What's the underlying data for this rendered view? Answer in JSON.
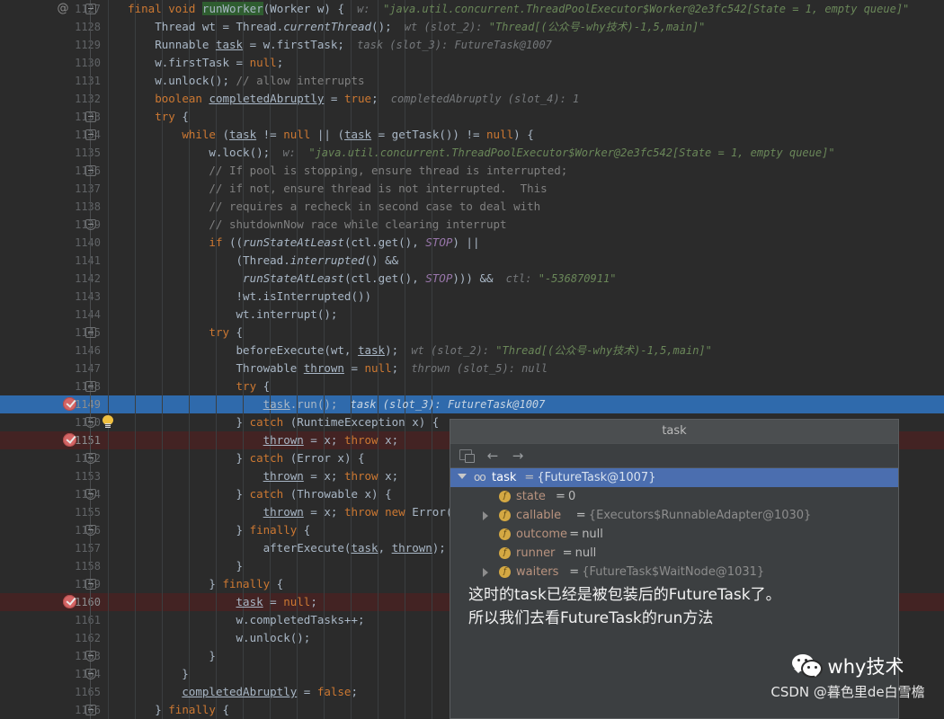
{
  "editor": {
    "first_line": 1127,
    "lines": [
      {
        "n": 1127,
        "indent": 0,
        "at": true,
        "fold": "start",
        "code": [
          {
            "t": "    ",
            "c": "txt"
          },
          {
            "t": "final",
            "c": "kw"
          },
          {
            "t": " ",
            "c": "txt"
          },
          {
            "t": "void",
            "c": "kw"
          },
          {
            "t": " ",
            "c": "txt"
          },
          {
            "t": "runWorker",
            "c": "hl"
          },
          {
            "t": "(Worker w) {",
            "c": "txt"
          }
        ],
        "hint": "  w:  ",
        "hintval": "\"java.util.concurrent.ThreadPoolExecutor$Worker@2e3fc542[State = 1, empty queue]\""
      },
      {
        "n": 1128,
        "code": [
          {
            "t": "        Thread wt = Thread.",
            "c": "txt"
          },
          {
            "t": "currentThread",
            "c": "itl"
          },
          {
            "t": "();",
            "c": "txt"
          }
        ],
        "hint": "  wt (slot_2): ",
        "hintval": "\"Thread[(公众号-why技术)-1,5,main]\""
      },
      {
        "n": 1129,
        "code": [
          {
            "t": "        Runnable ",
            "c": "txt"
          },
          {
            "t": "task",
            "c": "udl"
          },
          {
            "t": " = w.firstTask;",
            "c": "txt"
          }
        ],
        "hint": "  task (slot_3): FutureTask@1007",
        "hintval": ""
      },
      {
        "n": 1130,
        "code": [
          {
            "t": "        w.firstTask = ",
            "c": "txt"
          },
          {
            "t": "null",
            "c": "kw"
          },
          {
            "t": ";",
            "c": "txt"
          }
        ],
        "hint": "",
        "hintval": ""
      },
      {
        "n": 1131,
        "code": [
          {
            "t": "        w.unlock(); ",
            "c": "txt"
          },
          {
            "t": "// allow interrupts",
            "c": "cmt"
          }
        ],
        "hint": "",
        "hintval": ""
      },
      {
        "n": 1132,
        "code": [
          {
            "t": "        ",
            "c": "txt"
          },
          {
            "t": "boolean",
            "c": "kw"
          },
          {
            "t": " ",
            "c": "txt"
          },
          {
            "t": "completedAbruptly",
            "c": "udl"
          },
          {
            "t": " = ",
            "c": "txt"
          },
          {
            "t": "true",
            "c": "kw"
          },
          {
            "t": ";",
            "c": "txt"
          }
        ],
        "hint": "  completedAbruptly (slot_4): 1",
        "hintval": ""
      },
      {
        "n": 1133,
        "fold": "mid",
        "code": [
          {
            "t": "        ",
            "c": "txt"
          },
          {
            "t": "try",
            "c": "kw"
          },
          {
            "t": " {",
            "c": "txt"
          }
        ],
        "hint": "",
        "hintval": ""
      },
      {
        "n": 1134,
        "fold": "mid",
        "code": [
          {
            "t": "            ",
            "c": "txt"
          },
          {
            "t": "while",
            "c": "kw"
          },
          {
            "t": " (",
            "c": "txt"
          },
          {
            "t": "task",
            "c": "udl"
          },
          {
            "t": " != ",
            "c": "txt"
          },
          {
            "t": "null",
            "c": "kw"
          },
          {
            "t": " || (",
            "c": "txt"
          },
          {
            "t": "task",
            "c": "udl"
          },
          {
            "t": " = getTask()) != ",
            "c": "txt"
          },
          {
            "t": "null",
            "c": "kw"
          },
          {
            "t": ") {",
            "c": "txt"
          }
        ],
        "hint": "",
        "hintval": ""
      },
      {
        "n": 1135,
        "code": [
          {
            "t": "                w.lock();",
            "c": "txt"
          }
        ],
        "hint": "  w:  ",
        "hintval": "\"java.util.concurrent.ThreadPoolExecutor$Worker@2e3fc542[State = 1, empty queue]\""
      },
      {
        "n": 1136,
        "fold": "mid",
        "code": [
          {
            "t": "                // If pool is stopping, ensure thread is interrupted;",
            "c": "cmt"
          }
        ],
        "hint": "",
        "hintval": ""
      },
      {
        "n": 1137,
        "code": [
          {
            "t": "                // if not, ensure thread is not interrupted.  This",
            "c": "cmt"
          }
        ],
        "hint": "",
        "hintval": ""
      },
      {
        "n": 1138,
        "code": [
          {
            "t": "                // requires a recheck in second case to deal with",
            "c": "cmt"
          }
        ],
        "hint": "",
        "hintval": ""
      },
      {
        "n": 1139,
        "fold": "end",
        "code": [
          {
            "t": "                // shutdownNow race while clearing interrupt",
            "c": "cmt"
          }
        ],
        "hint": "",
        "hintval": ""
      },
      {
        "n": 1140,
        "code": [
          {
            "t": "                ",
            "c": "txt"
          },
          {
            "t": "if",
            "c": "kw"
          },
          {
            "t": " ((",
            "c": "txt"
          },
          {
            "t": "runStateAtLeast",
            "c": "itl"
          },
          {
            "t": "(ctl.get(), ",
            "c": "txt"
          },
          {
            "t": "STOP",
            "c": "stat"
          },
          {
            "t": ") ||",
            "c": "txt"
          }
        ],
        "hint": "",
        "hintval": ""
      },
      {
        "n": 1141,
        "code": [
          {
            "t": "                    (Thread.",
            "c": "txt"
          },
          {
            "t": "interrupted",
            "c": "itl"
          },
          {
            "t": "() &&",
            "c": "txt"
          }
        ],
        "hint": "",
        "hintval": ""
      },
      {
        "n": 1142,
        "code": [
          {
            "t": "                     ",
            "c": "txt"
          },
          {
            "t": "runStateAtLeast",
            "c": "itl"
          },
          {
            "t": "(ctl.get(), ",
            "c": "txt"
          },
          {
            "t": "STOP",
            "c": "stat"
          },
          {
            "t": "))) &&",
            "c": "txt"
          }
        ],
        "hint": "  ctl: ",
        "hintval": "\"-536870911\""
      },
      {
        "n": 1143,
        "code": [
          {
            "t": "                    !wt.isInterrupted())",
            "c": "txt"
          }
        ],
        "hint": "",
        "hintval": ""
      },
      {
        "n": 1144,
        "code": [
          {
            "t": "                    wt.interrupt();",
            "c": "txt"
          }
        ],
        "hint": "",
        "hintval": ""
      },
      {
        "n": 1145,
        "fold": "mid",
        "code": [
          {
            "t": "                ",
            "c": "txt"
          },
          {
            "t": "try",
            "c": "kw"
          },
          {
            "t": " {",
            "c": "txt"
          }
        ],
        "hint": "",
        "hintval": ""
      },
      {
        "n": 1146,
        "code": [
          {
            "t": "                    beforeExecute(wt, ",
            "c": "txt"
          },
          {
            "t": "task",
            "c": "udl"
          },
          {
            "t": ");",
            "c": "txt"
          }
        ],
        "hint": "  wt (slot_2): ",
        "hintval": "\"Thread[(公众号-why技术)-1,5,main]\""
      },
      {
        "n": 1147,
        "code": [
          {
            "t": "                    Throwable ",
            "c": "txt"
          },
          {
            "t": "thrown",
            "c": "udl"
          },
          {
            "t": " = ",
            "c": "txt"
          },
          {
            "t": "null",
            "c": "kw"
          },
          {
            "t": ";",
            "c": "txt"
          }
        ],
        "hint": "  thrown (slot_5): null",
        "hintval": ""
      },
      {
        "n": 1148,
        "fold": "mid",
        "code": [
          {
            "t": "                    ",
            "c": "txt"
          },
          {
            "t": "try",
            "c": "kw"
          },
          {
            "t": " {",
            "c": "txt"
          }
        ],
        "hint": "",
        "hintval": ""
      },
      {
        "n": 1149,
        "exec": true,
        "bp": true,
        "code": [
          {
            "t": "                        ",
            "c": "txt"
          },
          {
            "t": "task",
            "c": "udl"
          },
          {
            "t": ".run();",
            "c": "txt"
          }
        ],
        "hint": "  task (slot_3): FutureTask@1007",
        "hintval": ""
      },
      {
        "n": 1150,
        "fold": "end",
        "bulb": true,
        "code": [
          {
            "t": "                    } ",
            "c": "txt"
          },
          {
            "t": "catch",
            "c": "kw"
          },
          {
            "t": " (RuntimeException x) {",
            "c": "txt"
          }
        ],
        "hint": "",
        "hintval": ""
      },
      {
        "n": 1151,
        "bp": true,
        "bpline": true,
        "code": [
          {
            "t": "                        ",
            "c": "txt"
          },
          {
            "t": "thrown",
            "c": "udl"
          },
          {
            "t": " = x; ",
            "c": "txt"
          },
          {
            "t": "throw",
            "c": "kw"
          },
          {
            "t": " x;",
            "c": "txt"
          }
        ],
        "hint": "",
        "hintval": ""
      },
      {
        "n": 1152,
        "fold": "end",
        "code": [
          {
            "t": "                    } ",
            "c": "txt"
          },
          {
            "t": "catch",
            "c": "kw"
          },
          {
            "t": " (Error x) {",
            "c": "txt"
          }
        ],
        "hint": "",
        "hintval": ""
      },
      {
        "n": 1153,
        "code": [
          {
            "t": "                        ",
            "c": "txt"
          },
          {
            "t": "thrown",
            "c": "udl"
          },
          {
            "t": " = x; ",
            "c": "txt"
          },
          {
            "t": "throw",
            "c": "kw"
          },
          {
            "t": " x;",
            "c": "txt"
          }
        ],
        "hint": "",
        "hintval": ""
      },
      {
        "n": 1154,
        "fold": "end",
        "code": [
          {
            "t": "                    } ",
            "c": "txt"
          },
          {
            "t": "catch",
            "c": "kw"
          },
          {
            "t": " (Throwable x) {",
            "c": "txt"
          }
        ],
        "hint": "",
        "hintval": ""
      },
      {
        "n": 1155,
        "code": [
          {
            "t": "                        ",
            "c": "txt"
          },
          {
            "t": "thrown",
            "c": "udl"
          },
          {
            "t": " = x; ",
            "c": "txt"
          },
          {
            "t": "throw",
            "c": "kw"
          },
          {
            "t": " ",
            "c": "txt"
          },
          {
            "t": "new",
            "c": "kw"
          },
          {
            "t": " Error(x);",
            "c": "txt"
          }
        ],
        "hint": "",
        "hintval": ""
      },
      {
        "n": 1156,
        "fold": "end",
        "code": [
          {
            "t": "                    } ",
            "c": "txt"
          },
          {
            "t": "finally",
            "c": "kw"
          },
          {
            "t": " {",
            "c": "txt"
          }
        ],
        "hint": "",
        "hintval": ""
      },
      {
        "n": 1157,
        "code": [
          {
            "t": "                        afterExecute(",
            "c": "txt"
          },
          {
            "t": "task",
            "c": "udl"
          },
          {
            "t": ", ",
            "c": "txt"
          },
          {
            "t": "thrown",
            "c": "udl"
          },
          {
            "t": ");",
            "c": "txt"
          }
        ],
        "hint": "",
        "hintval": ""
      },
      {
        "n": 1158,
        "code": [
          {
            "t": "                    }",
            "c": "txt"
          }
        ],
        "hint": "",
        "hintval": ""
      },
      {
        "n": 1159,
        "fold": "mid",
        "code": [
          {
            "t": "                } ",
            "c": "txt"
          },
          {
            "t": "finally",
            "c": "kw"
          },
          {
            "t": " {",
            "c": "txt"
          }
        ],
        "hint": "",
        "hintval": ""
      },
      {
        "n": 1160,
        "bp": true,
        "bpline": true,
        "code": [
          {
            "t": "                    ",
            "c": "txt"
          },
          {
            "t": "task",
            "c": "udl"
          },
          {
            "t": " = ",
            "c": "txt"
          },
          {
            "t": "null",
            "c": "kw"
          },
          {
            "t": ";",
            "c": "txt"
          }
        ],
        "hint": "",
        "hintval": ""
      },
      {
        "n": 1161,
        "code": [
          {
            "t": "                    w.completedTasks++;",
            "c": "txt"
          }
        ],
        "hint": "",
        "hintval": ""
      },
      {
        "n": 1162,
        "code": [
          {
            "t": "                    w.unlock();",
            "c": "txt"
          }
        ],
        "hint": "",
        "hintval": ""
      },
      {
        "n": 1163,
        "fold": "end",
        "code": [
          {
            "t": "                }",
            "c": "txt"
          }
        ],
        "hint": "",
        "hintval": ""
      },
      {
        "n": 1164,
        "fold": "end",
        "code": [
          {
            "t": "            }",
            "c": "txt"
          }
        ],
        "hint": "",
        "hintval": ""
      },
      {
        "n": 1165,
        "code": [
          {
            "t": "            ",
            "c": "txt"
          },
          {
            "t": "completedAbruptly",
            "c": "udl"
          },
          {
            "t": " = ",
            "c": "txt"
          },
          {
            "t": "false",
            "c": "kw"
          },
          {
            "t": ";",
            "c": "txt"
          }
        ],
        "hint": "",
        "hintval": ""
      },
      {
        "n": 1166,
        "fold": "mid",
        "code": [
          {
            "t": "        } ",
            "c": "txt"
          },
          {
            "t": "finally",
            "c": "kw"
          },
          {
            "t": " {",
            "c": "txt"
          }
        ],
        "hint": "",
        "hintval": ""
      }
    ]
  },
  "popup": {
    "title": "task",
    "toolbar": {
      "frame_icon": "frame-icon",
      "back_icon": "arrow-left-icon",
      "forward_icon": "arrow-right-icon"
    },
    "tree": [
      {
        "depth": 0,
        "arrow": "down",
        "badge": "oo",
        "name": "task",
        "eq": "=",
        "value": "{FutureTask@1007}",
        "selected": true
      },
      {
        "depth": 1,
        "arrow": "none",
        "badge": "f",
        "name": "state",
        "eq": "=",
        "value": "0",
        "literal": true
      },
      {
        "depth": 1,
        "arrow": "right",
        "badge": "f",
        "name": "callable",
        "eq": "=",
        "value": "{Executors$RunnableAdapter@1030}"
      },
      {
        "depth": 1,
        "arrow": "none",
        "badge": "f",
        "name": "outcome",
        "eq": "=",
        "value": "null",
        "literal": true
      },
      {
        "depth": 1,
        "arrow": "none",
        "badge": "f",
        "name": "runner",
        "eq": "=",
        "value": "null",
        "literal": true
      },
      {
        "depth": 1,
        "arrow": "right",
        "badge": "f",
        "name": "waiters",
        "eq": "=",
        "value": "{FutureTask$WaitNode@1031}"
      }
    ],
    "note_line1": "这时的task已经是被包装后的FutureTask了。",
    "note_line2": "所以我们去看FutureTask的run方法"
  },
  "watermark": {
    "icon": "wechat-icon",
    "name": "why技术",
    "subtitle": "CSDN @暮色里de白雪檐"
  },
  "colors": {
    "background": "#2b2b2b",
    "exec_line": "#2f6aac",
    "breakpoint_line": "#432323",
    "breakpoint": "#d46565",
    "selection": "#4b6eaf",
    "keyword": "#cc7832",
    "string": "#6a8759",
    "comment": "#808080",
    "highlight": "#2f5d30"
  }
}
